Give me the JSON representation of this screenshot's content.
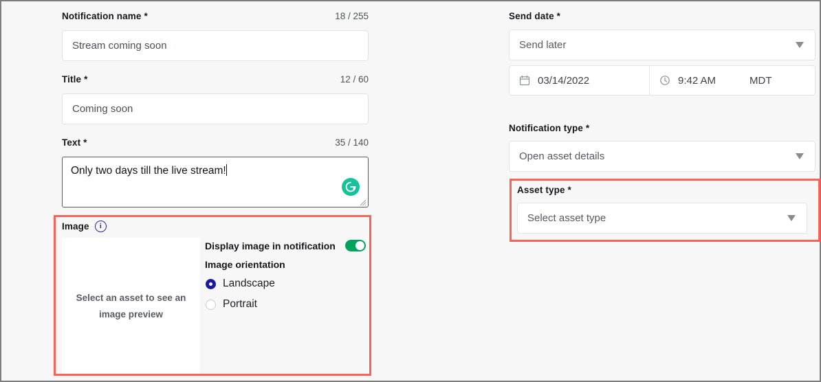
{
  "left_column": {
    "notification_name": {
      "label": "Notification name *",
      "char_count": "18 / 255",
      "value": "Stream coming soon"
    },
    "title": {
      "label": "Title *",
      "char_count": "12 / 60",
      "value": "Coming soon"
    },
    "text": {
      "label": "Text *",
      "char_count": "35 / 140",
      "value": "Only two days till the live stream!",
      "grammarly_icon": "grammarly-g-icon",
      "grammarly_glyph": "G"
    },
    "image_section": {
      "label": "Image",
      "info_icon": "info-icon",
      "info_glyph": "i",
      "preview_placeholder": "Select an asset to see an image preview",
      "display_toggle_label": "Display image in notification",
      "display_toggle_state": "on",
      "orientation_label": "Image orientation",
      "orientation_options": [
        {
          "label": "Landscape",
          "selected": true
        },
        {
          "label": "Portrait",
          "selected": false
        }
      ],
      "highlighted": true
    }
  },
  "right_column": {
    "send_date": {
      "label": "Send date *",
      "selected_option": "Send later",
      "date_icon": "calendar-icon",
      "date_value": "03/14/2022",
      "time_icon": "clock-icon",
      "time_value": "9:42 AM",
      "timezone": "MDT"
    },
    "notification_type": {
      "label": "Notification type *",
      "selected_option": "Open asset details"
    },
    "asset_type": {
      "label": "Asset type *",
      "selected_option": "Select asset type",
      "highlighted": true
    }
  },
  "colors": {
    "highlight_red": "#fa6355",
    "toggle_green": "#00a35c",
    "radio_indigo": "#1b1a9e",
    "grammarly_green": "#15c39a",
    "page_background": "#f7f7f8"
  }
}
